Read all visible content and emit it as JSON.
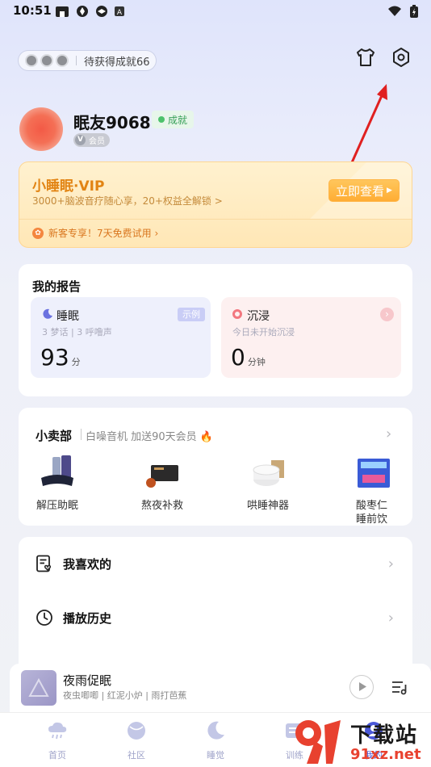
{
  "status_bar": {
    "time": "10:51"
  },
  "header": {
    "achievement_text": "待获得成就66"
  },
  "profile": {
    "nickname": "眠友9068",
    "achievement_tag": "成就",
    "member_tag": "会员",
    "member_badge": "V"
  },
  "vip": {
    "title": "小睡眠·VIP",
    "subtitle": "3000+脑波音疗随心享，20+权益全解锁 >",
    "button": "立即查看",
    "new_user": "新客专享！7天免费试用 ›"
  },
  "report": {
    "title": "我的报告",
    "sleep": {
      "title": "睡眠",
      "tag": "示例",
      "sub": "3 梦话 | 3 呼噜声",
      "value": "93",
      "unit": "分"
    },
    "immerse": {
      "title": "沉浸",
      "sub": "今日未开始沉浸",
      "value": "0",
      "unit": "分钟"
    }
  },
  "shop": {
    "title": "小卖部",
    "subtitle": "白噪音机 加送90天会员",
    "items": [
      {
        "label": "解压助眠"
      },
      {
        "label": "熬夜补救"
      },
      {
        "label": "哄睡神器"
      },
      {
        "label": "酸枣仁睡前饮"
      }
    ]
  },
  "menu": {
    "favorites": "我喜欢的",
    "history": "播放历史"
  },
  "player": {
    "title": "夜雨促眠",
    "subtitle": "夜虫唧唧 | 红泥小炉 | 雨打芭蕉"
  },
  "tabs": [
    {
      "label": "首页"
    },
    {
      "label": "社区"
    },
    {
      "label": "睡觉"
    },
    {
      "label": "训练"
    },
    {
      "label": "我的"
    }
  ],
  "watermark": {
    "brand": "下载站",
    "url": "91xz.net"
  },
  "colors": {
    "accent": "#e28413",
    "tab_inactive": "#9fa3c9",
    "arrow": "#e02020"
  }
}
